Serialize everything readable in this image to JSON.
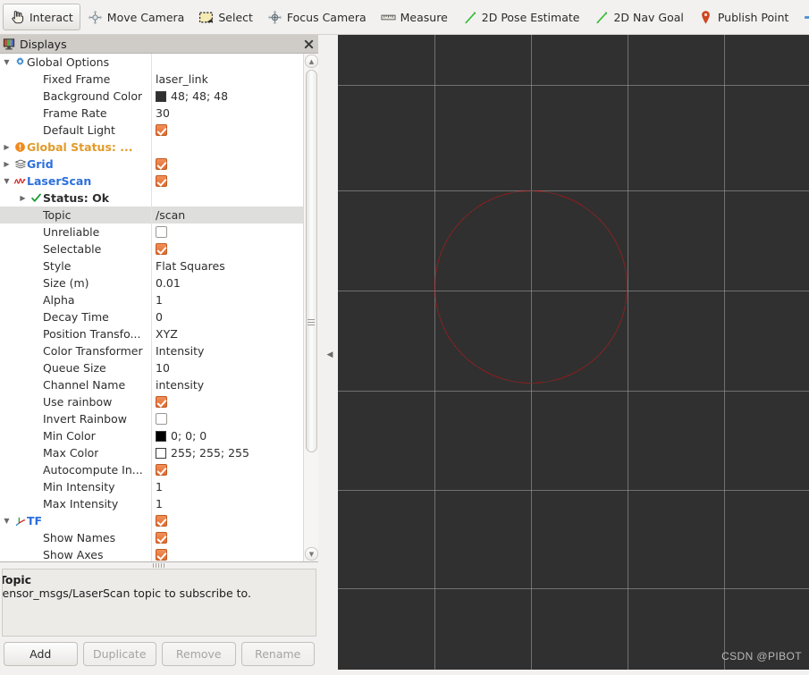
{
  "toolbar": {
    "items": [
      {
        "label": "Interact",
        "icon": "hand-cursor-icon",
        "active": true
      },
      {
        "label": "Move Camera",
        "icon": "move-camera-icon",
        "active": false
      },
      {
        "label": "Select",
        "icon": "select-rect-icon",
        "active": false
      },
      {
        "label": "Focus Camera",
        "icon": "focus-camera-icon",
        "active": false
      },
      {
        "label": "Measure",
        "icon": "ruler-icon",
        "active": false
      },
      {
        "label": "2D Pose Estimate",
        "icon": "green-arrow-icon",
        "active": false
      },
      {
        "label": "2D Nav Goal",
        "icon": "green-arrow-icon",
        "active": false
      },
      {
        "label": "Publish Point",
        "icon": "map-pin-icon",
        "active": false
      }
    ],
    "add_tool_icon": "plus-icon",
    "remove_tool_icon": "minus-icon"
  },
  "displays_panel": {
    "title": "Displays",
    "title_icon": "displays-monitor-icon",
    "close_icon": "close-icon",
    "rows": [
      {
        "id": "global-options",
        "indent": 0,
        "arrow": "down",
        "icon": "gear-icon",
        "label": "Global Options",
        "style": "plain",
        "value_type": "none"
      },
      {
        "id": "fixed-frame",
        "indent": 1,
        "arrow": "none",
        "icon": "none",
        "label": "Fixed Frame",
        "style": "plain",
        "value_type": "text",
        "value": "laser_link"
      },
      {
        "id": "background-color",
        "indent": 1,
        "arrow": "none",
        "icon": "none",
        "label": "Background Color",
        "style": "plain",
        "value_type": "color",
        "value": "48; 48; 48",
        "swatch": "#303030"
      },
      {
        "id": "frame-rate",
        "indent": 1,
        "arrow": "none",
        "icon": "none",
        "label": "Frame Rate",
        "style": "plain",
        "value_type": "text",
        "value": "30"
      },
      {
        "id": "default-light",
        "indent": 1,
        "arrow": "none",
        "icon": "none",
        "label": "Default Light",
        "style": "plain",
        "value_type": "checkbox",
        "checked": true
      },
      {
        "id": "global-status",
        "indent": 0,
        "arrow": "right",
        "icon": "warning-icon",
        "label": "Global Status: ...",
        "style": "orange",
        "value_type": "none"
      },
      {
        "id": "grid",
        "indent": 0,
        "arrow": "right",
        "icon": "grid-icon",
        "label": "Grid",
        "style": "blue",
        "value_type": "checkbox",
        "checked": true
      },
      {
        "id": "laserscan",
        "indent": 0,
        "arrow": "down",
        "icon": "laserscan-icon",
        "label": "LaserScan",
        "style": "blue",
        "value_type": "checkbox",
        "checked": true
      },
      {
        "id": "status-ok",
        "indent": 1,
        "arrow": "right",
        "icon": "check-icon",
        "label": "Status: Ok",
        "style": "bold",
        "value_type": "none"
      },
      {
        "id": "topic",
        "indent": 1,
        "arrow": "none",
        "icon": "none",
        "label": "Topic",
        "style": "plain",
        "value_type": "text",
        "value": "/scan",
        "selected": true
      },
      {
        "id": "unreliable",
        "indent": 1,
        "arrow": "none",
        "icon": "none",
        "label": "Unreliable",
        "style": "plain",
        "value_type": "checkbox",
        "checked": false
      },
      {
        "id": "selectable",
        "indent": 1,
        "arrow": "none",
        "icon": "none",
        "label": "Selectable",
        "style": "plain",
        "value_type": "checkbox",
        "checked": true
      },
      {
        "id": "style",
        "indent": 1,
        "arrow": "none",
        "icon": "none",
        "label": "Style",
        "style": "plain",
        "value_type": "text",
        "value": "Flat Squares"
      },
      {
        "id": "size-m",
        "indent": 1,
        "arrow": "none",
        "icon": "none",
        "label": "Size (m)",
        "style": "plain",
        "value_type": "text",
        "value": "0.01"
      },
      {
        "id": "alpha",
        "indent": 1,
        "arrow": "none",
        "icon": "none",
        "label": "Alpha",
        "style": "plain",
        "value_type": "text",
        "value": "1"
      },
      {
        "id": "decay-time",
        "indent": 1,
        "arrow": "none",
        "icon": "none",
        "label": "Decay Time",
        "style": "plain",
        "value_type": "text",
        "value": "0"
      },
      {
        "id": "position-transformer",
        "indent": 1,
        "arrow": "none",
        "icon": "none",
        "label": "Position Transfo...",
        "style": "plain",
        "value_type": "text",
        "value": "XYZ"
      },
      {
        "id": "color-transformer",
        "indent": 1,
        "arrow": "none",
        "icon": "none",
        "label": "Color Transformer",
        "style": "plain",
        "value_type": "text",
        "value": "Intensity"
      },
      {
        "id": "queue-size",
        "indent": 1,
        "arrow": "none",
        "icon": "none",
        "label": "Queue Size",
        "style": "plain",
        "value_type": "text",
        "value": "10"
      },
      {
        "id": "channel-name",
        "indent": 1,
        "arrow": "none",
        "icon": "none",
        "label": "Channel Name",
        "style": "plain",
        "value_type": "text",
        "value": "intensity"
      },
      {
        "id": "use-rainbow",
        "indent": 1,
        "arrow": "none",
        "icon": "none",
        "label": "Use rainbow",
        "style": "plain",
        "value_type": "checkbox",
        "checked": true
      },
      {
        "id": "invert-rainbow",
        "indent": 1,
        "arrow": "none",
        "icon": "none",
        "label": "Invert Rainbow",
        "style": "plain",
        "value_type": "checkbox",
        "checked": false
      },
      {
        "id": "min-color",
        "indent": 1,
        "arrow": "none",
        "icon": "none",
        "label": "Min Color",
        "style": "plain",
        "value_type": "color",
        "value": "0; 0; 0",
        "swatch": "#000000"
      },
      {
        "id": "max-color",
        "indent": 1,
        "arrow": "none",
        "icon": "none",
        "label": "Max Color",
        "style": "plain",
        "value_type": "color",
        "value": "255; 255; 255",
        "swatch": "#ffffff"
      },
      {
        "id": "autocompute-intensity",
        "indent": 1,
        "arrow": "none",
        "icon": "none",
        "label": "Autocompute In...",
        "style": "plain",
        "value_type": "checkbox",
        "checked": true
      },
      {
        "id": "min-intensity",
        "indent": 1,
        "arrow": "none",
        "icon": "none",
        "label": "Min Intensity",
        "style": "plain",
        "value_type": "text",
        "value": "1"
      },
      {
        "id": "max-intensity",
        "indent": 1,
        "arrow": "none",
        "icon": "none",
        "label": "Max Intensity",
        "style": "plain",
        "value_type": "text",
        "value": "1"
      },
      {
        "id": "tf",
        "indent": 0,
        "arrow": "down",
        "icon": "tf-axes-icon",
        "label": "TF",
        "style": "blue",
        "value_type": "checkbox",
        "checked": true
      },
      {
        "id": "show-names",
        "indent": 1,
        "arrow": "none",
        "icon": "none",
        "label": "Show Names",
        "style": "plain",
        "value_type": "checkbox",
        "checked": true
      },
      {
        "id": "show-axes",
        "indent": 1,
        "arrow": "none",
        "icon": "none",
        "label": "Show Axes",
        "style": "plain",
        "value_type": "checkbox",
        "checked": true
      }
    ],
    "help": {
      "title": "Topic",
      "body": "sensor_msgs/LaserScan topic to subscribe to."
    },
    "buttons": [
      {
        "label": "Add",
        "enabled": true
      },
      {
        "label": "Duplicate",
        "enabled": false
      },
      {
        "label": "Remove",
        "enabled": false
      },
      {
        "label": "Rename",
        "enabled": false
      }
    ]
  },
  "view3d": {
    "background_color": "#303030",
    "grid_color": "#9a9a9a",
    "scan_color": "#e01414",
    "collapse_arrow_icon": "chevron-left-icon",
    "watermark": "CSDN @PIBOT"
  }
}
